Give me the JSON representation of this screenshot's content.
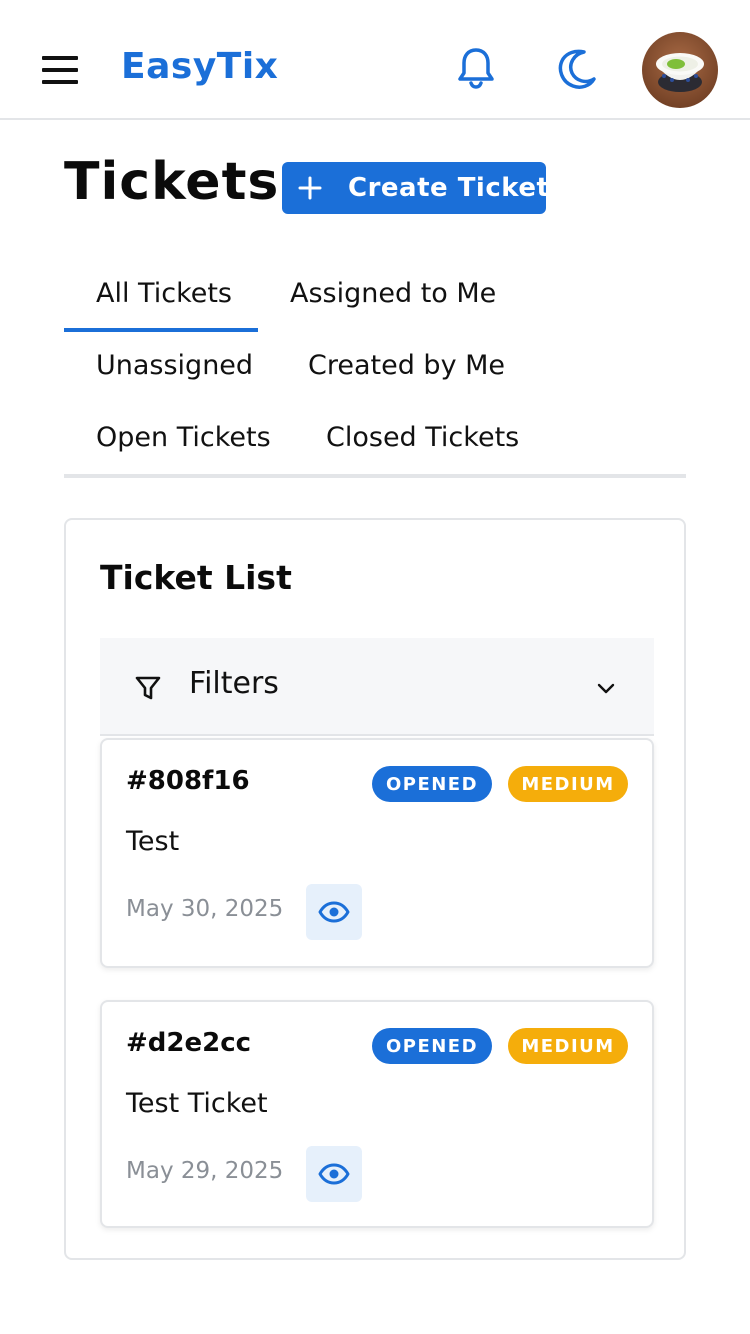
{
  "app": {
    "brand": "EasyTix"
  },
  "header": {
    "icons": [
      "menu-icon",
      "bell-icon",
      "moon-icon"
    ],
    "avatar_alt": ""
  },
  "page": {
    "title": "Tickets",
    "create_button_label": "Create Ticket"
  },
  "tabs": [
    {
      "label": "All Tickets",
      "active": true
    },
    {
      "label": "Assigned to Me",
      "active": false
    },
    {
      "label": "Unassigned",
      "active": false
    },
    {
      "label": "Created by Me",
      "active": false
    },
    {
      "label": "Open Tickets",
      "active": false
    },
    {
      "label": "Closed Tickets",
      "active": false
    }
  ],
  "ticket_list": {
    "title": "Ticket List",
    "filters_label": "Filters",
    "tickets": [
      {
        "id": "#808f16",
        "status": "OPENED",
        "priority": "MEDIUM",
        "subject": "Test",
        "date": "May 30, 2025"
      },
      {
        "id": "#d2e2cc",
        "status": "OPENED",
        "priority": "MEDIUM",
        "subject": "Test Ticket",
        "date": "May 29, 2025"
      }
    ]
  },
  "colors": {
    "accent": "#1b6fd8",
    "priority_medium": "#f5ad0b",
    "border": "#e3e5e8",
    "muted_text": "#8a8f96",
    "view_button_bg": "#e6f0fb"
  }
}
